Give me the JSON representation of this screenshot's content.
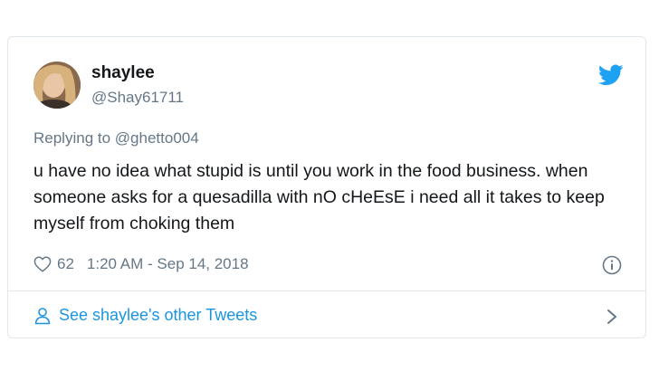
{
  "tweet": {
    "author": {
      "display_name": "shaylee",
      "handle": "@Shay61711"
    },
    "reply": {
      "prefix": "Replying to",
      "mention": "@ghetto004"
    },
    "text": "u have no idea what stupid is until you work in the food business. when someone asks for a quesadilla with nO cHeEsE i need all it takes to keep myself from choking them",
    "like_count": "62",
    "timestamp": "1:20 AM - Sep 14, 2018",
    "footer_link": "See shaylee's other Tweets"
  },
  "icons": {
    "brand": "twitter-bird-icon",
    "like": "heart-icon",
    "info": "info-icon",
    "person": "person-icon",
    "chevron": "chevron-right-icon"
  },
  "colors": {
    "accent": "#1b95e0",
    "secondary_text": "#657786",
    "primary_text": "#14171a",
    "border": "#e1e8ed"
  }
}
